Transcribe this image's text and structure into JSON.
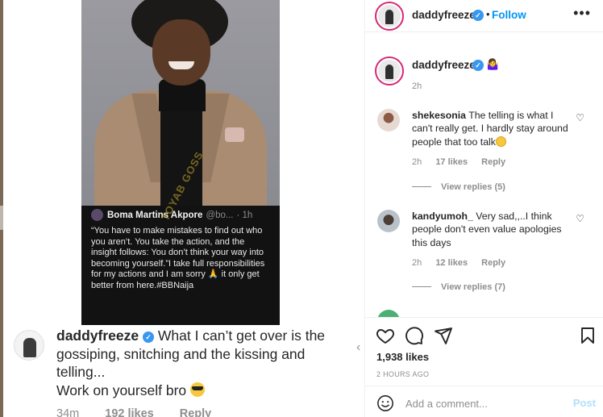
{
  "tweet": {
    "author": "Boma Martins Akpore",
    "handle": "@bo...",
    "time": "· 1h",
    "text": "“You have to make mistakes to find out who you aren’t. You take the action, and the insight follows: You don’t think your way into becoming yourself.”I take full responsibilities for my actions and I am sorry 🙏 it only get better from here.#BBNaija",
    "watermark": "TOYAB GOSS"
  },
  "caption": {
    "username": "daddyfreeze",
    "text": " What I can’t get over is the gossiping, snitching and the kissing and telling...",
    "text2": "Work on yourself bro ",
    "time": "34m",
    "likes": "192 likes",
    "reply": "Reply"
  },
  "header": {
    "username": "daddyfreeze",
    "dot": "•",
    "follow": "Follow",
    "more": "•••"
  },
  "post_owner": {
    "username": "daddyfreeze",
    "emoji": "🤷‍♀️",
    "time": "2h"
  },
  "comments": [
    {
      "username": "shekesonia",
      "text": " The telling is what I can't really get. I hardly stay around people that too talk",
      "time": "2h",
      "likes": "17 likes",
      "reply": "Reply",
      "view_replies": "View replies (5)"
    },
    {
      "username": "kandyumoh_",
      "text": "  Very sad,,..I think people don't even value apologies this days",
      "time": "2h",
      "likes": "12 likes",
      "reply": "Reply",
      "view_replies": "View replies (7)"
    }
  ],
  "actions": {
    "likes": "1,938 likes",
    "date": "2 HOURS AGO"
  },
  "add_comment": {
    "placeholder": "Add a comment...",
    "post": "Post"
  },
  "colors": {
    "link_blue": "#0095f6",
    "verified_blue": "#3897f0",
    "muted": "#8e8e8e",
    "story_ring": "#d62976"
  }
}
